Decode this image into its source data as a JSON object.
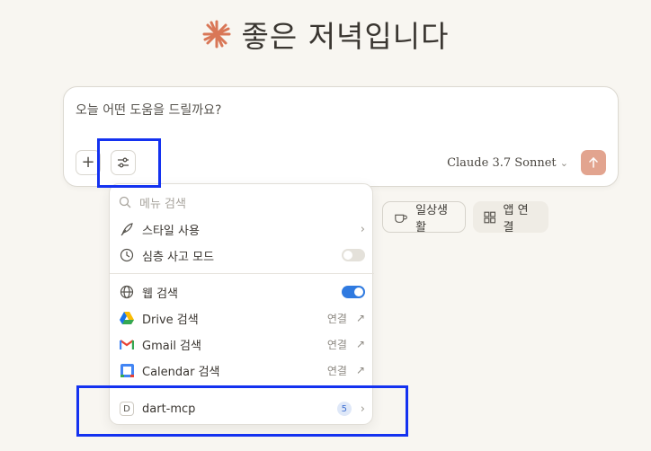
{
  "greeting": {
    "text": "좋은 저녁입니다"
  },
  "composer": {
    "placeholder": "오늘 어떤 도움을 드릴까요?",
    "plus_label": "+",
    "model": "Claude 3.7 Sonnet"
  },
  "chips": [
    {
      "label": "일상생활",
      "icon": "coffee-cup-icon"
    },
    {
      "label": "앱 연결",
      "icon": "grid-icon"
    }
  ],
  "menu": {
    "search_placeholder": "메뉴 검색",
    "items": [
      {
        "label": "스타일 사용",
        "icon": "feather-icon",
        "control": "chevron"
      },
      {
        "label": "심층 사고 모드",
        "icon": "clock-icon",
        "control": "toggle",
        "enabled": false
      },
      {
        "label": "웹 검색",
        "icon": "globe-icon",
        "control": "toggle",
        "enabled": true
      },
      {
        "label": "Drive 검색",
        "icon": "google-drive-icon",
        "connect": "연결"
      },
      {
        "label": "Gmail 검색",
        "icon": "gmail-icon",
        "connect": "연결"
      },
      {
        "label": "Calendar 검색",
        "icon": "google-calendar-icon",
        "connect": "연결"
      },
      {
        "label": "dart-mcp",
        "icon_letter": "D",
        "count": "5"
      }
    ]
  },
  "colors": {
    "background": "#f8f6f1",
    "accent": "#d97757",
    "send_button": "#e2a48f",
    "toggle_on": "#2f7ae0",
    "highlight": "#1432f0"
  }
}
